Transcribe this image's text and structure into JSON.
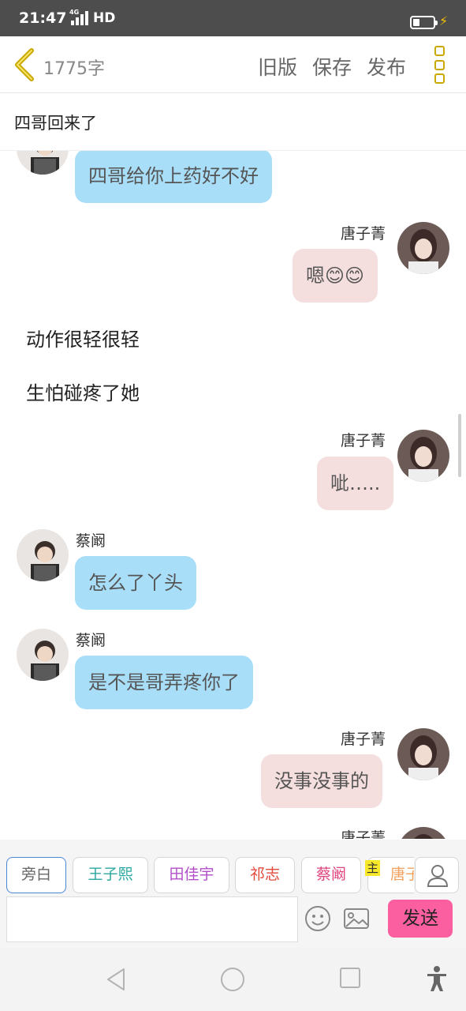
{
  "status_bar": {
    "time": "21:47",
    "network": "4G",
    "signal": "HD",
    "battery_level": 0.3
  },
  "top_bar": {
    "word_count": "1775字",
    "old_version": "旧版",
    "save": "保存",
    "publish": "发布"
  },
  "chapter_title": "四哥回来了",
  "chat": {
    "partial_top_bubble": "四哥给你上药好不好",
    "messages": [
      {
        "side": "right",
        "name": "唐子菁",
        "text": "嗯😊😊"
      },
      {
        "side": "narration",
        "text": "动作很轻很轻"
      },
      {
        "side": "narration",
        "text": "生怕碰疼了她"
      },
      {
        "side": "right",
        "name": "唐子菁",
        "text": "呲….."
      },
      {
        "side": "left",
        "name": "蔡阚",
        "text": "怎么了丫头"
      },
      {
        "side": "left",
        "name": "蔡阚",
        "text": "是不是哥弄疼你了"
      },
      {
        "side": "right",
        "name": "唐子菁",
        "text": "没事没事的"
      },
      {
        "side": "right",
        "name": "唐子菁",
        "text": ""
      }
    ]
  },
  "characters": {
    "chips": [
      {
        "label": "旁白",
        "color": "#666666"
      },
      {
        "label": "王子熙",
        "color": "#2aa7a0"
      },
      {
        "label": "田佳宇",
        "color": "#b14fc9"
      },
      {
        "label": "祁志",
        "color": "#e24a3b"
      },
      {
        "label": "蔡阚",
        "color": "#e0457e"
      },
      {
        "label": "唐子",
        "color": "#f3a15c"
      }
    ],
    "main_badge": "主"
  },
  "composer": {
    "placeholder": "",
    "send_label": "发送"
  },
  "colors": {
    "accent_send": "#fc5fa0",
    "bubble_left": "#a9def9",
    "bubble_right": "#f4dede",
    "back_arrow": "#c9a800"
  }
}
